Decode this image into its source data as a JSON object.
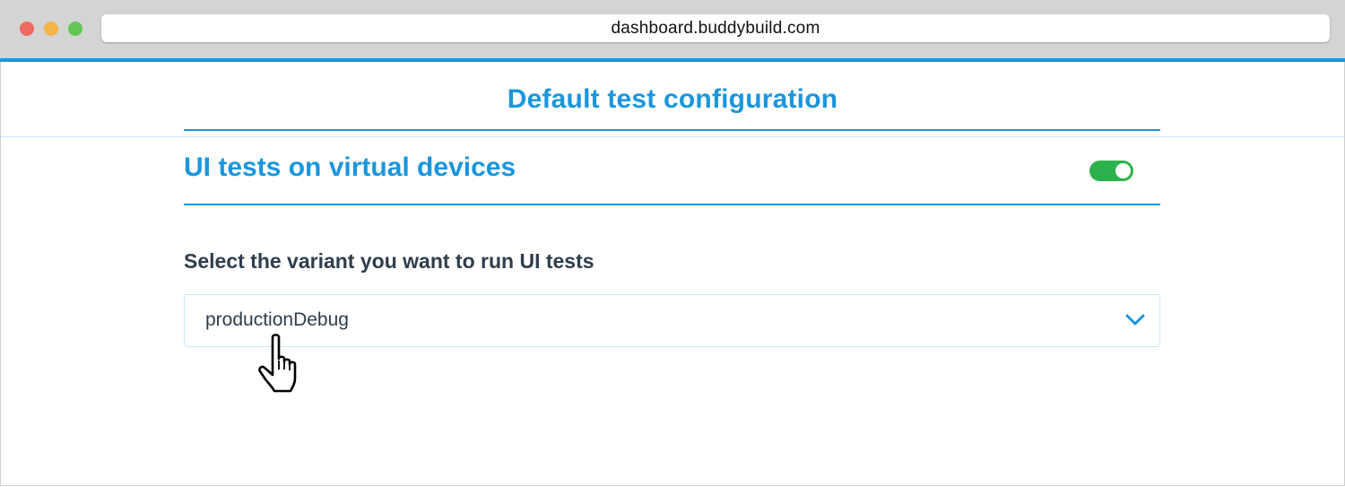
{
  "browser": {
    "url": "dashboard.buddybuild.com"
  },
  "header": {
    "title": "Default test configuration"
  },
  "section": {
    "title": "UI tests on virtual devices",
    "toggle_on": true
  },
  "variant_field": {
    "label": "Select the variant you want to run UI tests",
    "selected_value": "productionDebug"
  },
  "icons": {
    "select_arrow": "chevron-down-icon",
    "pointer": "hand-pointer-icon"
  },
  "colors": {
    "accent": "#1a96dd",
    "toggle_on": "#2bb24c",
    "text_dark": "#2f3d4c"
  }
}
